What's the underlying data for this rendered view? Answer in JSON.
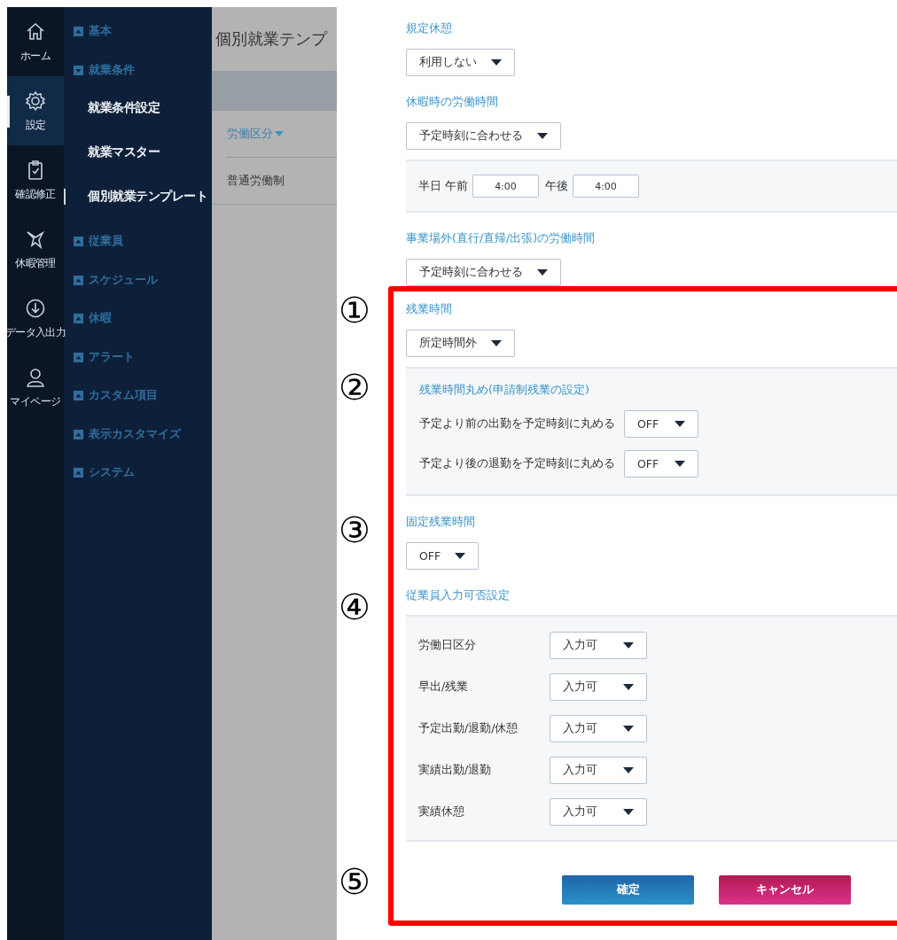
{
  "icon_rail": [
    {
      "label": "ホーム",
      "selected": false
    },
    {
      "label": "設定",
      "selected": true
    },
    {
      "label": "確認修正",
      "selected": false
    },
    {
      "label": "休暇管理",
      "selected": false
    },
    {
      "label": "データ入出力",
      "selected": false
    },
    {
      "label": "マイページ",
      "selected": false
    }
  ],
  "menu": [
    {
      "label": "基本",
      "expanded": false
    },
    {
      "label": "就業条件",
      "expanded": true,
      "children": [
        {
          "label": "就業条件設定",
          "selected": false
        },
        {
          "label": "就業マスター",
          "selected": false
        },
        {
          "label": "個別就業テンプレート",
          "selected": true
        }
      ]
    },
    {
      "label": "従業員",
      "expanded": false
    },
    {
      "label": "スケジュール",
      "expanded": false
    },
    {
      "label": "休暇",
      "expanded": false
    },
    {
      "label": "アラート",
      "expanded": false
    },
    {
      "label": "カスタム項目",
      "expanded": false
    },
    {
      "label": "表示カスタマイズ",
      "expanded": false
    },
    {
      "label": "システム",
      "expanded": false
    }
  ],
  "list_panel": {
    "title": "個別就業テンプ",
    "column": "労働区分",
    "rows": [
      "普通労働制"
    ]
  },
  "form": [
    {
      "kind": "field",
      "label": "規定休憩",
      "value": "利用しない",
      "highlighted": false
    },
    {
      "kind": "field",
      "label": "休暇時の労働時間",
      "value": "予定時刻に合わせる",
      "highlighted": false
    },
    {
      "kind": "times",
      "highlighted": false,
      "inputs": [
        {
          "label": "半日 午前",
          "value": "4:00"
        },
        {
          "label": "午後",
          "value": "4:00"
        }
      ]
    },
    {
      "kind": "field",
      "label": "事業場外(直行/直帰/出張)の労働時間",
      "value": "予定時刻に合わせる",
      "highlighted": false
    },
    {
      "kind": "field",
      "label": "残業時間",
      "value": "所定時間外",
      "highlighted": true,
      "marker": "①"
    },
    {
      "kind": "group",
      "title": "残業時間丸め(申請制残業の設定)",
      "highlighted": true,
      "marker": "②",
      "rows": [
        {
          "label": "予定より前の出勤を予定時刻に丸める",
          "value": "OFF"
        },
        {
          "label": "予定より後の退勤を予定時刻に丸める",
          "value": "OFF"
        }
      ]
    },
    {
      "kind": "field",
      "label": "固定残業時間",
      "value": "OFF",
      "highlighted": true,
      "marker": "③"
    },
    {
      "kind": "table",
      "label": "従業員入力可否設定",
      "highlighted": true,
      "marker": "④",
      "rows": [
        {
          "label": "労働日区分",
          "value": "入力可"
        },
        {
          "label": "早出/残業",
          "value": "入力可"
        },
        {
          "label": "予定出勤/退勤/休憩",
          "value": "入力可"
        },
        {
          "label": "実績出勤/退勤",
          "value": "入力可"
        },
        {
          "label": "実績休憩",
          "value": "入力可"
        }
      ]
    },
    {
      "kind": "buttons",
      "highlighted": true,
      "marker": "⑤",
      "buttons": [
        {
          "label": "確定",
          "kind": "primary"
        },
        {
          "label": "キャンセル",
          "kind": "danger"
        }
      ]
    }
  ]
}
